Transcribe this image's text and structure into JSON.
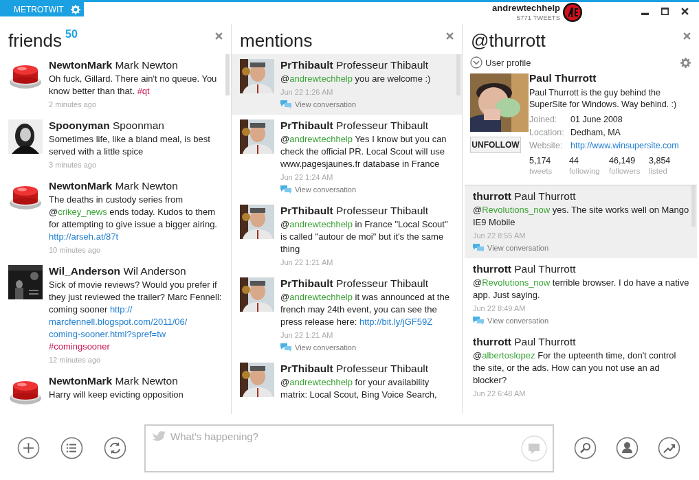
{
  "app": {
    "title": "METROTWIT"
  },
  "account": {
    "username": "andrewtechhelp",
    "tweet_count": "5771 TWEETS"
  },
  "columns": [
    {
      "kind": "timeline",
      "title": "friends",
      "count": "50",
      "tweets": [
        {
          "handle": "NewtonMark",
          "name": "Mark Newton",
          "selected": false,
          "parts": [
            {
              "kind": "text",
              "text": "Oh fuck, Gillard. There ain't no queue. You know better than that. "
            },
            {
              "kind": "hashtag",
              "text": "#qt"
            }
          ],
          "time": "2 minutes ago"
        },
        {
          "handle": "Spoonyman",
          "name": "Spoonman",
          "selected": false,
          "parts": [
            {
              "kind": "text",
              "text": "Sometimes life, like a bland meal, is best served with a little spice"
            }
          ],
          "time": "3 minutes ago"
        },
        {
          "handle": "NewtonMark",
          "name": "Mark Newton",
          "selected": false,
          "parts": [
            {
              "kind": "text",
              "text": "The deaths in custody series from @"
            },
            {
              "kind": "mention",
              "text": "crikey_news"
            },
            {
              "kind": "text",
              "text": " ends today. Kudos to them for attempting to give issue a bigger airing. "
            },
            {
              "kind": "link",
              "text": "http://arseh.at/87t"
            }
          ],
          "time": "10 minutes ago"
        },
        {
          "handle": "Wil_Anderson",
          "name": "Wil Anderson",
          "selected": false,
          "parts": [
            {
              "kind": "text",
              "text": "Sick of movie reviews? Would you prefer if they just reviewed the trailer? Marc Fennell: coming sooner "
            },
            {
              "kind": "link",
              "text": "http://"
            },
            {
              "kind": "link",
              "text": "marcfennell.blogspot.com/2011/06/"
            },
            {
              "kind": "link",
              "text": "coming-sooner.html?spref=tw"
            },
            {
              "kind": "hashtag",
              "text": "#comingsooner"
            }
          ],
          "time": "12 minutes ago"
        },
        {
          "handle": "NewtonMark",
          "name": "Mark Newton",
          "selected": false,
          "parts": [
            {
              "kind": "text",
              "text": "Harry will keep evicting opposition"
            }
          ]
        }
      ]
    },
    {
      "kind": "timeline",
      "title": "mentions",
      "tweets": [
        {
          "handle": "PrThibault",
          "name": "Professeur Thibault",
          "selected": true,
          "parts": [
            {
              "kind": "text",
              "text": "@"
            },
            {
              "kind": "mention",
              "text": "andrewtechhelp"
            },
            {
              "kind": "text",
              "text": " you are welcome :)"
            }
          ],
          "time": "Jun 22 1:26 AM",
          "conversation": "View conversation"
        },
        {
          "handle": "PrThibault",
          "name": "Professeur Thibault",
          "selected": false,
          "parts": [
            {
              "kind": "text",
              "text": "@"
            },
            {
              "kind": "mention",
              "text": "andrewtechhelp"
            },
            {
              "kind": "text",
              "text": " Yes I know but you can check the official PR. Local Scout will use www.pagesjaunes.fr database in France"
            }
          ],
          "time": "Jun 22 1:24 AM",
          "conversation": "View conversation"
        },
        {
          "handle": "PrThibault",
          "name": "Professeur Thibault",
          "selected": false,
          "parts": [
            {
              "kind": "text",
              "text": "@"
            },
            {
              "kind": "mention",
              "text": "andrewtechhelp"
            },
            {
              "kind": "text",
              "text": " in France \"Local Scout\" is called \"autour de moi\" but it's the same thing"
            }
          ],
          "time": "Jun 22 1:21 AM"
        },
        {
          "handle": "PrThibault",
          "name": "Professeur Thibault",
          "selected": false,
          "parts": [
            {
              "kind": "text",
              "text": "@"
            },
            {
              "kind": "mention",
              "text": "andrewtechhelp"
            },
            {
              "kind": "text",
              "text": " it was announced at the french may 24th event, you can see the press release here: "
            },
            {
              "kind": "link",
              "text": "http://bit.ly/jGF59Z"
            }
          ],
          "time": "Jun 22 1:21 AM",
          "conversation": "View conversation"
        },
        {
          "handle": "PrThibault",
          "name": "Professeur Thibault",
          "selected": false,
          "parts": [
            {
              "kind": "text",
              "text": "@"
            },
            {
              "kind": "mention",
              "text": "andrewtechhelp"
            },
            {
              "kind": "text",
              "text": " for your availability matrix: Local Scout, Bing Voice Search,"
            }
          ]
        }
      ]
    },
    {
      "kind": "profile",
      "title": "@thurrott",
      "profile": {
        "section": "User profile",
        "name": "Paul Thurrott",
        "bio": "Paul Thurrott is the guy behind the SuperSite for Windows. Way behind. :)",
        "button": "UNFOLLOW",
        "fields": [
          {
            "label": "Joined:",
            "value": "01 June 2008",
            "kind": "text"
          },
          {
            "label": "Location:",
            "value": "Dedham, MA",
            "kind": "text"
          },
          {
            "label": "Website:",
            "value": "http://www.winsupersite.com",
            "kind": "link"
          }
        ],
        "stats": [
          {
            "value": "5,174",
            "label": "tweets"
          },
          {
            "value": "44",
            "label": "following"
          },
          {
            "value": "46,149",
            "label": "followers"
          },
          {
            "value": "3,854",
            "label": "listed"
          }
        ]
      },
      "tweets": [
        {
          "handle": "thurrott",
          "name": "Paul Thurrott",
          "selected": true,
          "parts": [
            {
              "kind": "text",
              "text": "@"
            },
            {
              "kind": "mention",
              "text": "Revolutions_now"
            },
            {
              "kind": "text",
              "text": " yes. The site works well on Mango IE9 Mobile"
            }
          ],
          "time": "Jun 22 8:55 AM",
          "conversation": "View conversation"
        },
        {
          "handle": "thurrott",
          "name": "Paul Thurrott",
          "selected": false,
          "parts": [
            {
              "kind": "text",
              "text": "@"
            },
            {
              "kind": "mention",
              "text": "Revolutions_now"
            },
            {
              "kind": "text",
              "text": " terrible browser. I do have a native app. Just saying."
            }
          ],
          "time": "Jun 22 8:49 AM",
          "conversation": "View conversation"
        },
        {
          "handle": "thurrott",
          "name": "Paul Thurrott",
          "selected": false,
          "parts": [
            {
              "kind": "text",
              "text": "@"
            },
            {
              "kind": "mention",
              "text": "albertoslopez"
            },
            {
              "kind": "text",
              "text": " For the upteenth time, don't control the site, or the ads. How can you not use an ad blocker?"
            }
          ],
          "time": "Jun 22 6:48 AM"
        }
      ]
    }
  ],
  "composer": {
    "placeholder": "What's happening?"
  }
}
